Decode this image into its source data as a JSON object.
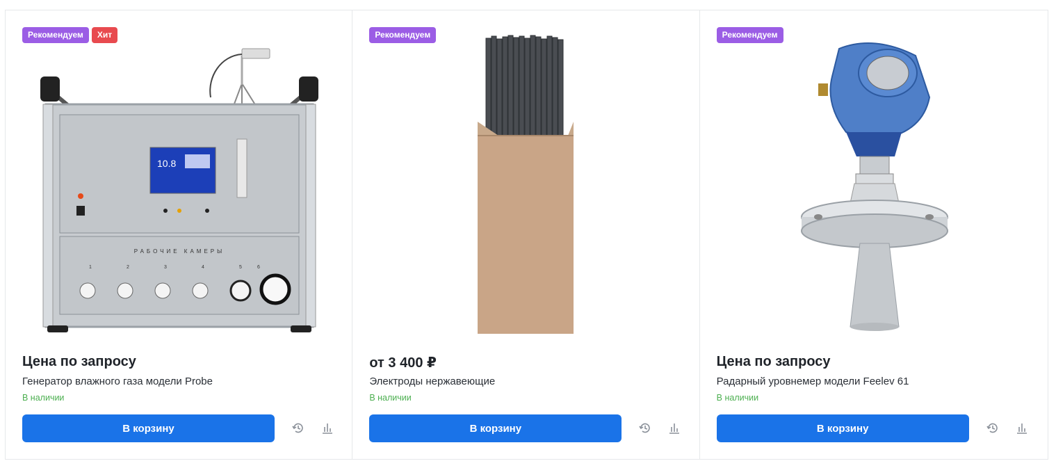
{
  "products": [
    {
      "badges": [
        "Рекомендуем",
        "Хит"
      ],
      "price": "Цена по запросу",
      "title": "Генератор влажного газа модели Probe",
      "stock": "В наличии",
      "cart_label": "В корзину",
      "image_icon": "humidity-generator-image",
      "screen_text": "10.8",
      "panel_text": "РАБОЧИЕ КАМЕРЫ",
      "chambers": [
        "1",
        "2",
        "3",
        "4",
        "5",
        "6"
      ]
    },
    {
      "badges": [
        "Рекомендуем"
      ],
      "price": "от 3 400 ₽",
      "title": "Электроды нержавеющие",
      "stock": "В наличии",
      "cart_label": "В корзину",
      "image_icon": "electrodes-box-image"
    },
    {
      "badges": [
        "Рекомендуем"
      ],
      "price": "Цена по запросу",
      "title": "Радарный уровнемер модели Feelev 61",
      "stock": "В наличии",
      "cart_label": "В корзину",
      "image_icon": "radar-level-meter-image"
    }
  ],
  "colors": {
    "badge_recommend": "#9b5de5",
    "badge_hit": "#e84a4f",
    "button": "#1a73e8",
    "in_stock": "#4caf50"
  },
  "icons": {
    "history": "history-icon",
    "compare": "compare-chart-icon"
  }
}
